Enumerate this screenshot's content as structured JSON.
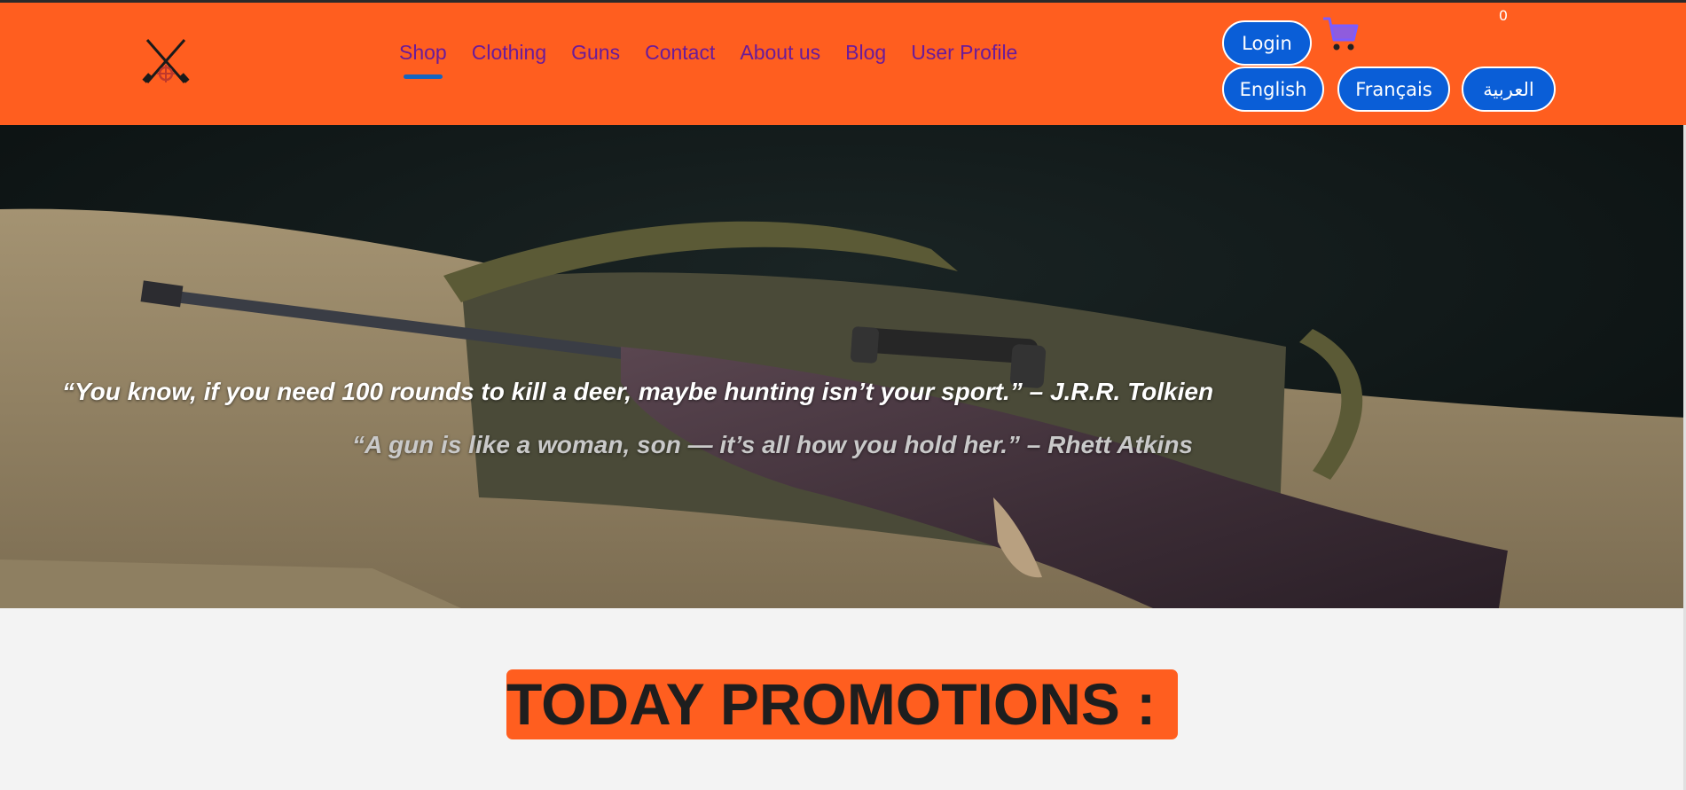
{
  "header": {
    "logo_icon": "crossed-rifles-crosshair-icon",
    "nav": [
      {
        "label": "Shop",
        "active": true
      },
      {
        "label": "Clothing",
        "active": false
      },
      {
        "label": "Guns",
        "active": false
      },
      {
        "label": "Contact",
        "active": false
      },
      {
        "label": "About us",
        "active": false
      },
      {
        "label": "Blog",
        "active": false
      },
      {
        "label": "User Profile",
        "active": false
      }
    ],
    "login_label": "Login",
    "cart_icon": "shopping-cart-icon",
    "cart_count": "0",
    "languages": [
      "English",
      "Français",
      "العربية"
    ]
  },
  "hero": {
    "quote1": "“You know, if you need 100 rounds to kill a deer, maybe hunting isn’t your sport.” – J.R.R. Tolkien",
    "quote2": "“A gun is like a woman, son — it’s all how you hold her.” – Rhett Atkins"
  },
  "promotions": {
    "title": "TODAY PROMOTIONS :"
  },
  "colors": {
    "header_bg": "#ff5e1f",
    "nav_text": "#6a1b9a",
    "button_bg": "#0a5ed7",
    "active_underline": "#1565c0",
    "page_bg": "#f3f3f3"
  }
}
